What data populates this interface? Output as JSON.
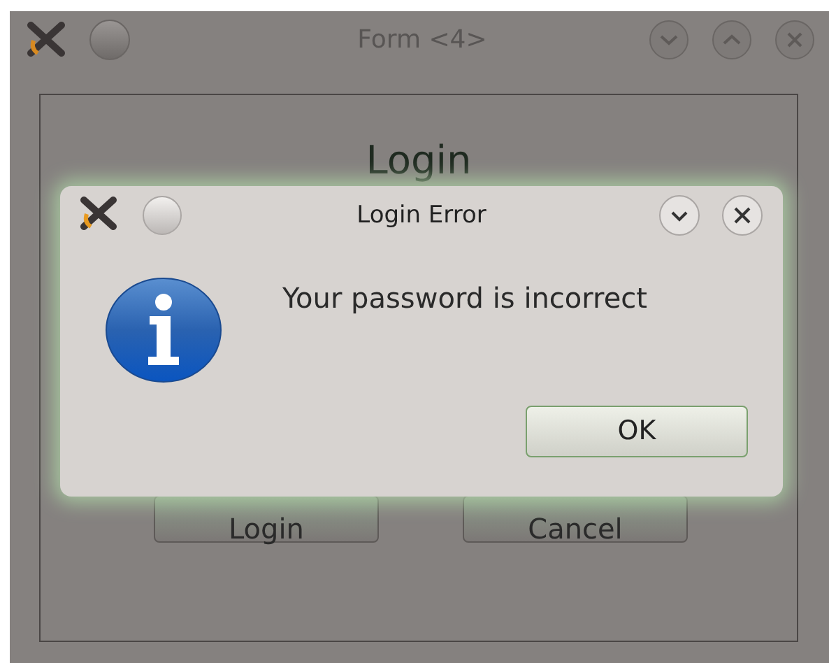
{
  "window": {
    "title": "Form <4>"
  },
  "form": {
    "heading": "Login",
    "buttons": [
      "Login",
      "Cancel"
    ]
  },
  "dialog": {
    "title": "Login Error",
    "message": "Your password is incorrect",
    "buttons": [
      "OK"
    ]
  }
}
